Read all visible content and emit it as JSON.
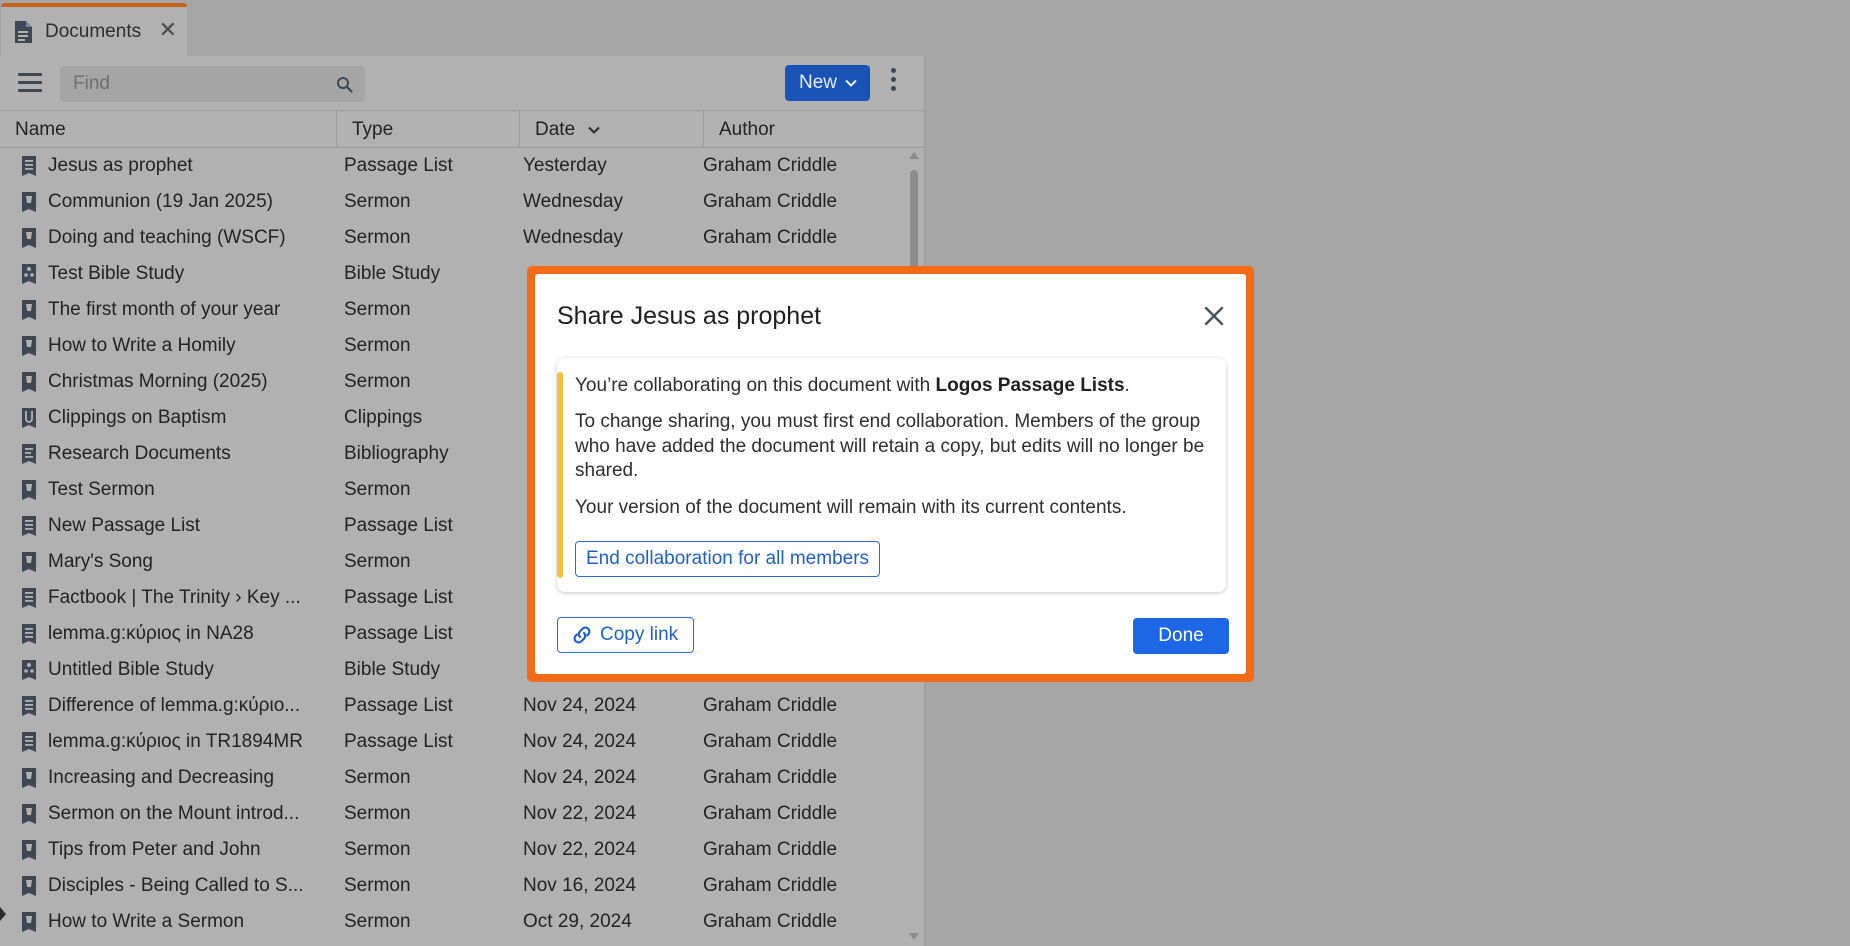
{
  "tab": {
    "label": "Documents",
    "close_glyph": "✕"
  },
  "toolbar": {
    "find_placeholder": "Find",
    "new_label": "New"
  },
  "columns": {
    "name": "Name",
    "type": "Type",
    "date": "Date",
    "author": "Author"
  },
  "rows": [
    {
      "icon": "passage-list",
      "name": "Jesus as prophet",
      "type": "Passage List",
      "date": "Yesterday",
      "author": "Graham Criddle"
    },
    {
      "icon": "sermon",
      "name": "Communion (19 Jan 2025)",
      "type": "Sermon",
      "date": "Wednesday",
      "author": "Graham Criddle"
    },
    {
      "icon": "sermon",
      "name": "Doing and teaching (WSCF)",
      "type": "Sermon",
      "date": "Wednesday",
      "author": "Graham Criddle"
    },
    {
      "icon": "bible-study",
      "name": "Test Bible Study",
      "type": "Bible Study",
      "date": "",
      "author": ""
    },
    {
      "icon": "sermon",
      "name": "The first month of your year",
      "type": "Sermon",
      "date": "",
      "author": ""
    },
    {
      "icon": "sermon",
      "name": "How to Write a Homily",
      "type": "Sermon",
      "date": "",
      "author": ""
    },
    {
      "icon": "sermon",
      "name": "Christmas Morning (2025)",
      "type": "Sermon",
      "date": "",
      "author": ""
    },
    {
      "icon": "clippings",
      "name": "Clippings on Baptism",
      "type": "Clippings",
      "date": "",
      "author": ""
    },
    {
      "icon": "bibliography",
      "name": "Research Documents",
      "type": "Bibliography",
      "date": "",
      "author": ""
    },
    {
      "icon": "sermon",
      "name": "Test Sermon",
      "type": "Sermon",
      "date": "",
      "author": ""
    },
    {
      "icon": "passage-list",
      "name": "New Passage List",
      "type": "Passage List",
      "date": "",
      "author": ""
    },
    {
      "icon": "sermon",
      "name": "Mary's Song",
      "type": "Sermon",
      "date": "",
      "author": ""
    },
    {
      "icon": "passage-list",
      "name": "Factbook | The Trinity › Key ...",
      "type": "Passage List",
      "date": "",
      "author": ""
    },
    {
      "icon": "passage-list",
      "name": "lemma.g:κύριος in NA28",
      "type": "Passage List",
      "date": "",
      "author": ""
    },
    {
      "icon": "bible-study",
      "name": "Untitled Bible Study",
      "type": "Bible Study",
      "date": "",
      "author": ""
    },
    {
      "icon": "passage-list",
      "name": "Difference of lemma.g:κύριο...",
      "type": "Passage List",
      "date": "Nov 24, 2024",
      "author": "Graham Criddle"
    },
    {
      "icon": "passage-list",
      "name": "lemma.g:κύριος in TR1894MR",
      "type": "Passage List",
      "date": "Nov 24, 2024",
      "author": "Graham Criddle"
    },
    {
      "icon": "sermon",
      "name": "Increasing and Decreasing",
      "type": "Sermon",
      "date": "Nov 24, 2024",
      "author": "Graham Criddle"
    },
    {
      "icon": "sermon",
      "name": "Sermon on the Mount introd...",
      "type": "Sermon",
      "date": "Nov 22, 2024",
      "author": "Graham Criddle"
    },
    {
      "icon": "sermon",
      "name": "Tips from Peter and John",
      "type": "Sermon",
      "date": "Nov 22, 2024",
      "author": "Graham Criddle"
    },
    {
      "icon": "sermon",
      "name": "Disciples - Being Called to S...",
      "type": "Sermon",
      "date": "Nov 16, 2024",
      "author": "Graham Criddle"
    },
    {
      "icon": "sermon",
      "name": "How to Write a Sermon",
      "type": "Sermon",
      "date": "Oct 29, 2024",
      "author": "Graham Criddle"
    }
  ],
  "dialog": {
    "title": "Share Jesus as prophet",
    "p1_prefix": "You’re collaborating on this document with ",
    "p1_group": "Logos Passage Lists",
    "p1_suffix": ".",
    "p2": "To change sharing, you must first end collaboration. Members of the group who have added the document will retain a copy, but edits will no longer be shared.",
    "p3": "Your version of the document will remain with its current contents.",
    "end_label": "End collaboration for all members",
    "copy_label": "Copy link",
    "done_label": "Done"
  },
  "colors": {
    "accent_frame": "#f36b16",
    "primary_button": "#1d67e6",
    "link_blue": "#1f5fc9",
    "notice_stripe": "#f3c33b",
    "icon_dark": "#3d4854"
  }
}
